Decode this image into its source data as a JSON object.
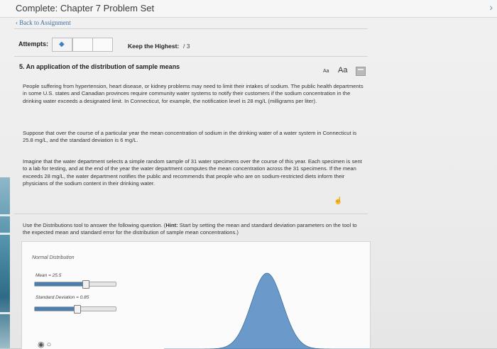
{
  "page": {
    "title": "Complete: Chapter 7 Problem Set",
    "back_link": "‹ Back to Assignment"
  },
  "attempts": {
    "label": "Attempts:",
    "keep_label": "Keep the Highest:",
    "keep_value": "/ 3"
  },
  "question": {
    "title": "5. An application of the distribution of sample means",
    "font_small": "Aa",
    "font_large": "Aa",
    "para1": "People suffering from hypertension, heart disease, or kidney problems may need to limit their intakes of sodium. The public health departments in some U.S. states and Canadian provinces require community water systems to notify their customers if the sodium concentration in the drinking water exceeds a designated limit. In Connecticut, for example, the notification level is 28 mg/L (milligrams per liter).",
    "para2": "Suppose that over the course of a particular year the mean concentration of sodium in the drinking water of a water system in Connecticut is 25.8 mg/L, and the standard deviation is 6 mg/L.",
    "para3": "Imagine that the water department selects a simple random sample of 31 water specimens over the course of this year. Each specimen is sent to a lab for testing, and at the end of the year the water department computes the mean concentration across the 31 specimens. If the mean exceeds 28 mg/L, the water department notifies the public and recommends that people who are on sodium-restricted diets inform their physicians of the sodium content in their drinking water.",
    "instruction_pre": "Use the Distributions tool to answer the following question. (",
    "instruction_hint_label": "Hint:",
    "instruction_post": " Start by setting the mean and standard deviation parameters on the tool to the expected mean and standard error for the distribution of sample mean concentrations.)"
  },
  "tool": {
    "title": "Normal Distribution",
    "mean_label": "Mean = 25.5",
    "sd_label": "Standard Deviation = 0.85",
    "mean_slider_fraction": 0.62,
    "sd_slider_fraction": 0.52
  },
  "colors": {
    "curve_fill": "#5b8fc4",
    "slider_fill": "#4a7fb0",
    "link": "#3d6fa0"
  },
  "icons": {
    "attempt": "diamond-icon",
    "calculator": "calculator-icon",
    "cursor": "hand-cursor-icon"
  }
}
